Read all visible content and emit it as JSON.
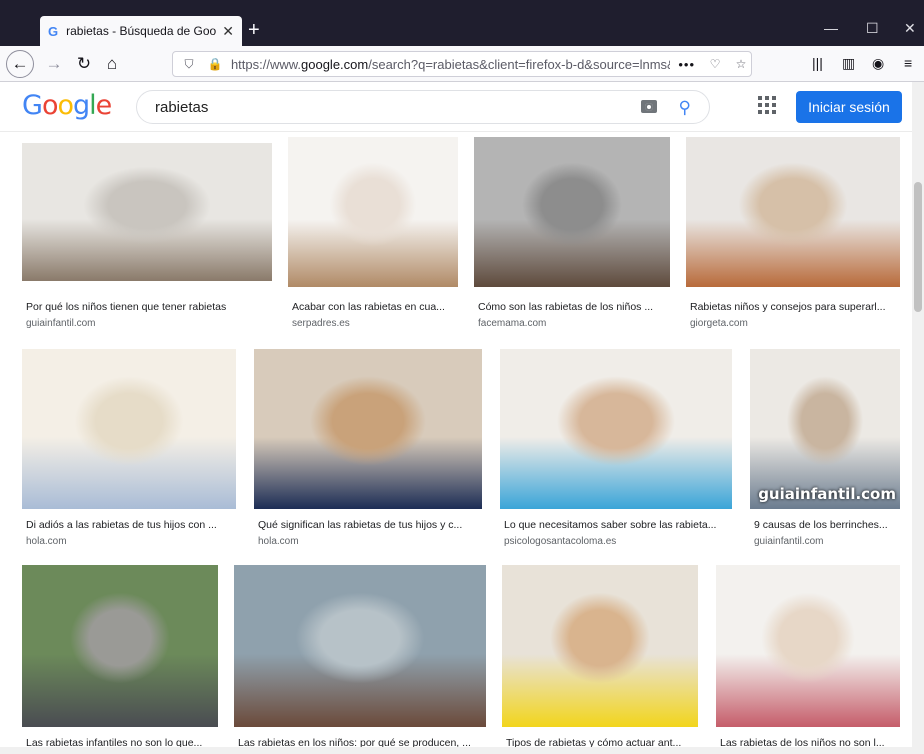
{
  "browser": {
    "tab_title": "rabietas - Búsqueda de Google",
    "tab_favicon": "G",
    "tab_close": "✕",
    "new_tab": "+",
    "url_host": "https://www.",
    "url_domain": "google.com",
    "url_path": "/search?q=rabietas&client=firefox-b-d&source=lnms&tb",
    "more": "•••"
  },
  "google": {
    "logo": [
      "G",
      "o",
      "o",
      "g",
      "l",
      "e"
    ],
    "query": "rabietas",
    "signin_label": "Iniciar sesión"
  },
  "results": [
    {
      "title": "Por qué los niños tienen que tener rabietas",
      "source": "guiainfantil.com",
      "colors": [
        "#e8e6e2",
        "#c9c5bf",
        "#8a7a6a"
      ]
    },
    {
      "title": "Acabar con las rabietas en cua...",
      "source": "serpadres.es",
      "colors": [
        "#f5f3f0",
        "#e9dfd6",
        "#b08a66"
      ]
    },
    {
      "title": "Cómo son las rabietas de los niños ...",
      "source": "facemama.com",
      "colors": [
        "#b4b4b4",
        "#8d8d8d",
        "#5e4a3c"
      ]
    },
    {
      "title": "Rabietas niños y consejos para superarl...",
      "source": "giorgeta.com",
      "colors": [
        "#e9e6e3",
        "#d6c0a8",
        "#b86a3a"
      ]
    },
    {
      "title": "Di adiós a las rabietas de tus hijos con ...",
      "source": "hola.com",
      "colors": [
        "#f4efe6",
        "#e6dcc8",
        "#a9bcd6"
      ]
    },
    {
      "title": "Qué significan las rabietas de tus hijos y c...",
      "source": "hola.com",
      "colors": [
        "#d8cbbb",
        "#c9a27a",
        "#1c2d55"
      ]
    },
    {
      "title": "Lo que necesitamos saber sobre las rabieta...",
      "source": "psicologosantacoloma.es",
      "colors": [
        "#f0ede8",
        "#d7b79a",
        "#3aa5d8"
      ]
    },
    {
      "title": "9 causas de los berrinches...",
      "source": "guiainfantil.com",
      "colors": [
        "#ece9e4",
        "#c9b5a0",
        "#6b7c8f"
      ],
      "watermark": "guiainfantil.com"
    },
    {
      "title": "Las rabietas infantiles no son lo que...",
      "source": "",
      "colors": [
        "#6c8a5a",
        "#9a9a96",
        "#4a4c52"
      ]
    },
    {
      "title": "Las rabietas en los niños: por qué se producen, ...",
      "source": "",
      "colors": [
        "#8fa1ad",
        "#b7c2c8",
        "#6b4a3a"
      ]
    },
    {
      "title": "Tipos de rabietas y cómo actuar ant...",
      "source": "",
      "colors": [
        "#e8e2d8",
        "#d9b48e",
        "#f2d51c"
      ]
    },
    {
      "title": "Las rabietas de los niños no son l...",
      "source": "",
      "colors": [
        "#f3f1ee",
        "#e7d7c7",
        "#c55d6a"
      ]
    }
  ]
}
